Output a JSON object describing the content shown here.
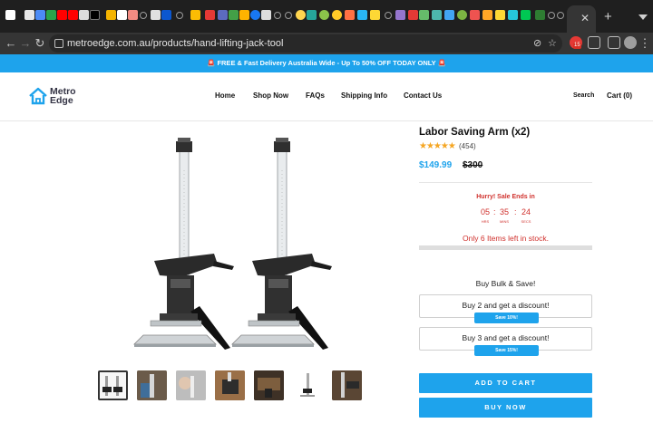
{
  "browser": {
    "url": "metroedge.com.au/products/hand-lifting-jack-tool",
    "extension_badge": "15"
  },
  "announcement": "🚨 FREE & Fast Delivery Australia Wide - Up To 50% OFF TODAY ONLY 🚨",
  "header": {
    "logo_line1": "Metro",
    "logo_line2": "Edge",
    "nav": [
      "Home",
      "Shop Now",
      "FAQs",
      "Shipping Info",
      "Contact Us"
    ],
    "search_label": "Search",
    "cart_label": "Cart (0)"
  },
  "product": {
    "title": "Labor Saving Arm (x2)",
    "stars": "★★★★★",
    "rating_count": "(454)",
    "price": "$149.99",
    "compare_price": "$300"
  },
  "countdown": {
    "heading": "Hurry! Sale Ends in",
    "hours": "05",
    "minutes": "35",
    "seconds": "24",
    "hours_label": "HRS",
    "minutes_label": "MINS",
    "seconds_label": "SECS",
    "separator": ":"
  },
  "stock": {
    "text": "Only 6 Items left in stock.",
    "fill_fraction": 0.0
  },
  "bulk": {
    "title": "Buy Bulk & Save!",
    "offers": [
      {
        "label": "Buy 2 and get a discount!",
        "badge": "Save 10%!"
      },
      {
        "label": "Buy 3 and get a discount!",
        "badge": "Save 15%!"
      }
    ]
  },
  "buttons": {
    "add_to_cart": "ADD TO CART",
    "buy_now": "BUY NOW"
  },
  "colors": {
    "accent": "#1ea3ec",
    "sale_red": "#d0312d",
    "star": "#f5a623"
  }
}
